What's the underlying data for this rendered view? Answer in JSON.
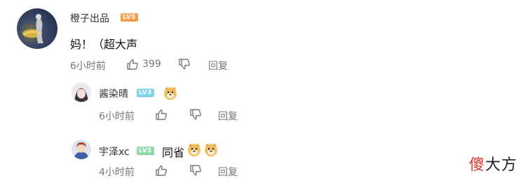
{
  "comments": [
    {
      "username": "橙子出品",
      "level": "LV5",
      "text": "妈！（超大声",
      "time": "6小时前",
      "likes": "399",
      "reply_label": "回复"
    },
    {
      "username": "酱染晴",
      "level": "LV3",
      "emoji": "doge",
      "time": "6小时前",
      "reply_label": "回复"
    },
    {
      "username": "宇泽xc",
      "level": "LV5",
      "text": "同省",
      "emoji": "doge",
      "time": "4小时前",
      "reply_label": "回复"
    }
  ],
  "watermark": {
    "part1": "傻",
    "part2": "大方"
  },
  "colors": {
    "lv_orange": "#f6a04d",
    "lv_blue": "#7fd4ec",
    "lv_green": "#8fd8a8",
    "watermark_red": "#d93a2b"
  }
}
